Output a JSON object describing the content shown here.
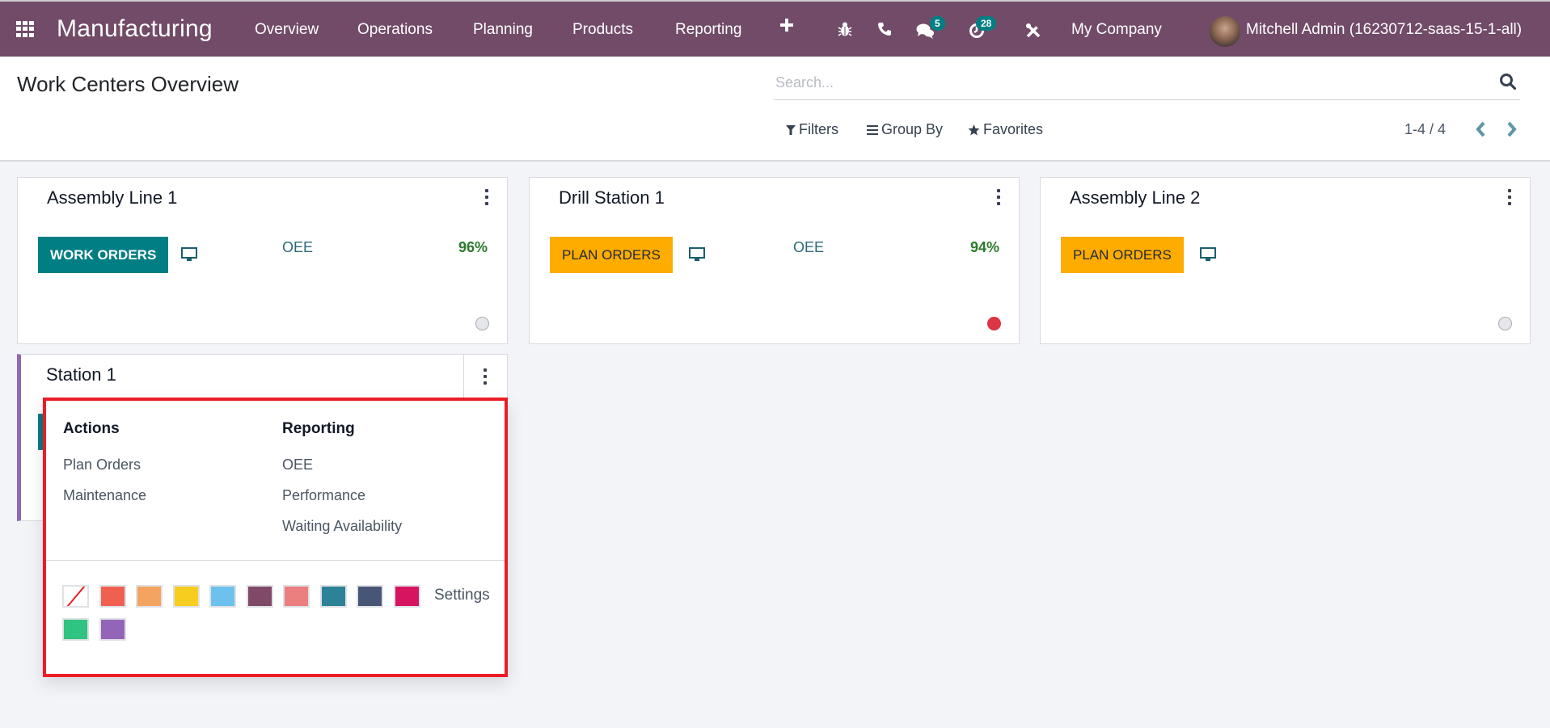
{
  "navbar": {
    "app_name": "Manufacturing",
    "menu": [
      "Overview",
      "Operations",
      "Planning",
      "Products",
      "Reporting"
    ],
    "icons": {
      "apps": "apps-grid-icon",
      "quick_create": "plus-icon",
      "debug": "bug-icon",
      "phone": "phone-icon",
      "messages": "chat-icon",
      "activities": "clock-icon",
      "settings": "tools-icon"
    },
    "messages_badge": "5",
    "activities_badge": "28",
    "company": "My Company",
    "user": "Mitchell Admin (16230712-saas-15-1-all)"
  },
  "control_panel": {
    "title": "Work Centers Overview",
    "search_placeholder": "Search...",
    "filters_label": "Filters",
    "group_by_label": "Group By",
    "favorites_label": "Favorites",
    "pager": "1-4 / 4"
  },
  "cards": [
    {
      "name": "Assembly Line 1",
      "button_label": "WORK ORDERS",
      "button_style": "teal",
      "oee_label": "OEE",
      "oee_value": "96%",
      "status": "normal",
      "status_color": "#e5e7eb"
    },
    {
      "name": "Drill Station 1",
      "button_label": "PLAN ORDERS",
      "button_style": "amber",
      "oee_label": "OEE",
      "oee_value": "94%",
      "status": "blocked",
      "status_color": "#dc3545"
    },
    {
      "name": "Assembly Line 2",
      "button_label": "PLAN ORDERS",
      "button_style": "amber",
      "status": "normal",
      "status_color": "#e5e7eb"
    },
    {
      "name": "Station 1",
      "color": "#9367b5"
    }
  ],
  "dropdown": {
    "actions_header": "Actions",
    "actions": [
      "Plan Orders",
      "Maintenance"
    ],
    "reporting_header": "Reporting",
    "reporting": [
      "OEE",
      "Performance",
      "Waiting Availability"
    ],
    "colors": [
      "none",
      "#f06050",
      "#f4a460",
      "#f7cd1f",
      "#6cc1ed",
      "#814968",
      "#eb7e7f",
      "#2c8397",
      "#475577",
      "#d6145f",
      "#30c381",
      "#9365b8"
    ],
    "settings_label": "Settings"
  }
}
